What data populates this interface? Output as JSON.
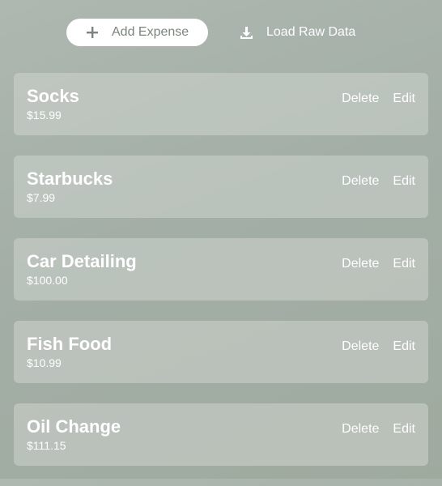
{
  "toolbar": {
    "add_label": "Add Expense",
    "add_icon": "plus-icon",
    "load_label": "Load Raw Data",
    "load_icon": "download-icon"
  },
  "expenses": [
    {
      "name": "Socks",
      "amount": "$15.99",
      "delete_label": "Delete",
      "edit_label": "Edit"
    },
    {
      "name": "Starbucks",
      "amount": "$7.99",
      "delete_label": "Delete",
      "edit_label": "Edit"
    },
    {
      "name": "Car Detailing",
      "amount": "$100.00",
      "delete_label": "Delete",
      "edit_label": "Edit"
    },
    {
      "name": "Fish Food",
      "amount": "$10.99",
      "delete_label": "Delete",
      "edit_label": "Edit"
    },
    {
      "name": "Oil Change",
      "amount": "$111.15",
      "delete_label": "Delete",
      "edit_label": "Edit"
    }
  ],
  "colors": {
    "background": "#a3aea6",
    "card": "#c3cbc4",
    "text": "#ffffff",
    "button_text": "#7a857d"
  }
}
